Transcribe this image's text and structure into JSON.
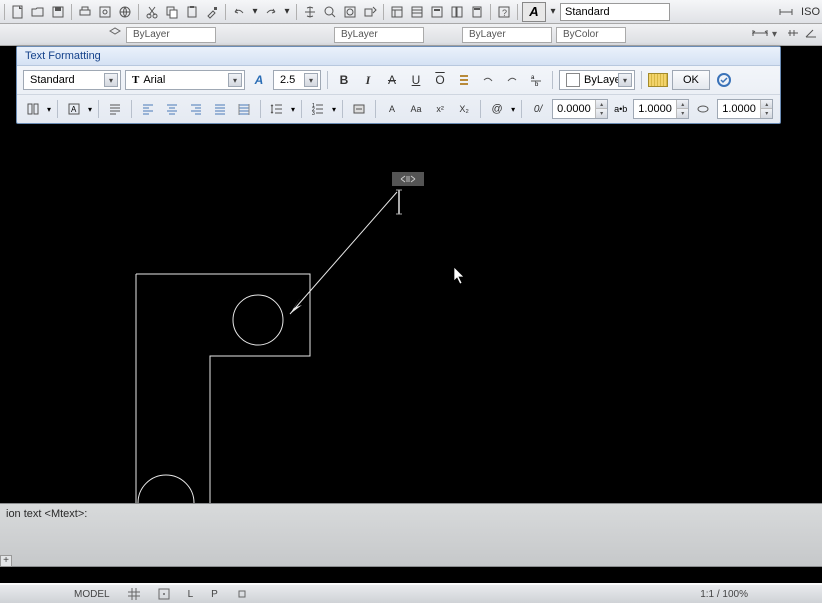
{
  "toolbar": {
    "style_name": "Standard",
    "right_label": "ISO"
  },
  "props": {
    "bylayer_a": "ByLayer",
    "bylayer_b": "ByLayer",
    "bylayer_c": "ByLayer",
    "bycolor": "ByColor"
  },
  "text_panel": {
    "title": "Text Formatting",
    "style": "Standard",
    "font": "Arial",
    "font_prefix": "T",
    "annotative_icon": "A",
    "height": "2.5",
    "btn_bold": "B",
    "btn_italic": "I",
    "btn_strike": "A",
    "btn_underline": "U",
    "btn_overline": "O",
    "color_mode": "ByLayer",
    "ok_label": "OK",
    "tracking": "0.0000",
    "ab_label": "a•b",
    "width_factor": "1.0000",
    "oblique": "1.0000",
    "at_label": "@",
    "obl_label": "0/",
    "sup_label": "x²",
    "sub_label": "X₂",
    "aa_small": "Aa",
    "aa_caps": "aA",
    "caps_a": "A"
  },
  "command": {
    "line1": "ion text <Mtext>:",
    "plus": "+"
  },
  "status": {
    "model": "MODEL",
    "l": "L",
    "p": "P",
    "scale": "1:1 / 100%"
  }
}
